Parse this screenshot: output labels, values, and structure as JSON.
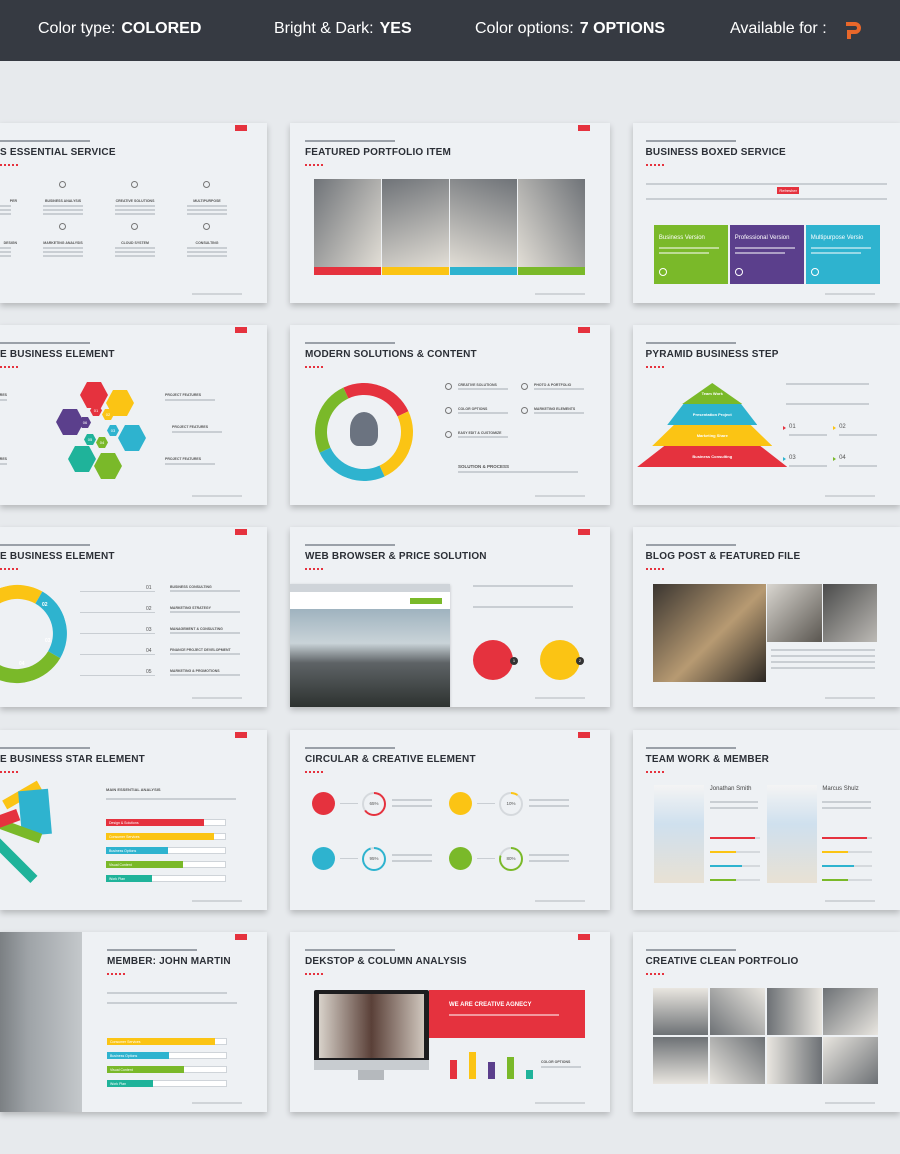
{
  "header": {
    "color_type_label": "Color type:",
    "color_type_value": "COLORED",
    "bright_dark_label": "Bright & Dark:",
    "bright_dark_value": "YES",
    "color_options_label": "Color options:",
    "color_options_value": "7 OPTIONS",
    "available_label": "Available for :",
    "app_icon": "powerpoint-icon"
  },
  "colors": {
    "red": "#e5323e",
    "yellow": "#fbc414",
    "blue": "#2eb3cf",
    "green": "#7ab929",
    "purple": "#5b3f8c",
    "teal": "#1fb39a",
    "header_bg": "#363a42",
    "app_orange": "#e8672a"
  },
  "slides": [
    {
      "title": "S ESSENTIAL SERVICE",
      "services": [
        "PER",
        "BUSINESS ANALYSIS",
        "CREATIVE SOLUTIONS",
        "MULTIPURPOSE",
        "DESIGN",
        "MARKETING ANALYSIS",
        "CLOUD SYSTEM",
        "CONSULTING"
      ]
    },
    {
      "title": "FEATURED PORTFOLIO ITEM"
    },
    {
      "title": "BUSINESS BOXED SERVICE",
      "tag": "Refresher",
      "boxes": [
        "Business Version",
        "Professional Version",
        "Multipurpose Versio"
      ]
    },
    {
      "title": "E BUSINESS ELEMENT",
      "hex_numbers": [
        "01",
        "02",
        "03",
        "04",
        "05",
        "06"
      ],
      "feature_label": "PROJECT FEATURES"
    },
    {
      "title": "MODERN SOLUTIONS & CONTENT",
      "features": [
        "CREATIVE SOLUTIONS",
        "PHOTO & PORTFOLIO",
        "COLOR OPTIONS",
        "MARKETING ELEMENTS",
        "EASY EDIT & CUSTOMIZE"
      ],
      "process_title": "SOLUTION & PROCESS"
    },
    {
      "title": "PYRAMID BUSINESS STEP",
      "levels": [
        "Team Work",
        "Presentation Project",
        "Marketing Share",
        "Business Consulting"
      ],
      "steps": [
        "01",
        "02",
        "03",
        "04"
      ]
    },
    {
      "title": "E BUSINESS ELEMENT",
      "segments": [
        "02",
        "03",
        "04"
      ],
      "list_numbers": [
        "01",
        "02",
        "03",
        "04",
        "05"
      ],
      "list_labels": [
        "BUSINESS CONSULTING",
        "MARKETING STRATEGY",
        "MANAGEMENT & CONSULTING",
        "FINANCE PROJECT DEVELOPMENT",
        "MARKETING & PROMOTIONS"
      ]
    },
    {
      "title": "WEB BROWSER & PRICE SOLUTION",
      "steps": [
        "1",
        "2"
      ]
    },
    {
      "title": "BLOG POST & FEATURED FILE"
    },
    {
      "title": "E BUSINESS STAR ELEMENT",
      "analysis_title": "MAIN ESSENTIAL ANALYSIS",
      "bars": [
        {
          "label": "Design & Solutions",
          "value": 0.82
        },
        {
          "label": "Consumer Services",
          "value": 0.9
        },
        {
          "label": "Business Options",
          "value": 0.52
        },
        {
          "label": "Visual Content",
          "value": 0.64
        },
        {
          "label": "Work Plan",
          "value": 0.38
        }
      ]
    },
    {
      "title": "CIRCULAR & CREATIVE ELEMENT",
      "items": [
        {
          "pct": "65%",
          "value": 0.65
        },
        {
          "pct": "10%",
          "value": 0.1
        },
        {
          "pct": "95%",
          "value": 0.95
        },
        {
          "pct": "80%",
          "value": 0.8
        }
      ]
    },
    {
      "title": "TEAM WORK & MEMBER",
      "members": [
        {
          "name": "Jonathan Smith",
          "skills": [
            0.9,
            0.52,
            0.64,
            0.52
          ]
        },
        {
          "name": "Marcus Shulz",
          "skills": [
            0.9,
            0.52,
            0.64,
            0.52
          ]
        }
      ]
    },
    {
      "title": "MEMBER: JOHN MARTIN",
      "bars": [
        {
          "label": "Consumer Services",
          "value": 0.9
        },
        {
          "label": "Business Options",
          "value": 0.52
        },
        {
          "label": "Visual Content",
          "value": 0.64
        },
        {
          "label": "Work Plan",
          "value": 0.38
        }
      ]
    },
    {
      "title": "DEKSTOP & COLUMN ANALYSIS",
      "banner": "WE ARE CREATIVE AGNECY",
      "columns": [
        0.62,
        0.9,
        0.58,
        0.74,
        0.3
      ],
      "legend_title": "COLOR OPTIONS"
    },
    {
      "title": "CREATIVE CLEAN PORTFOLIO"
    }
  ]
}
